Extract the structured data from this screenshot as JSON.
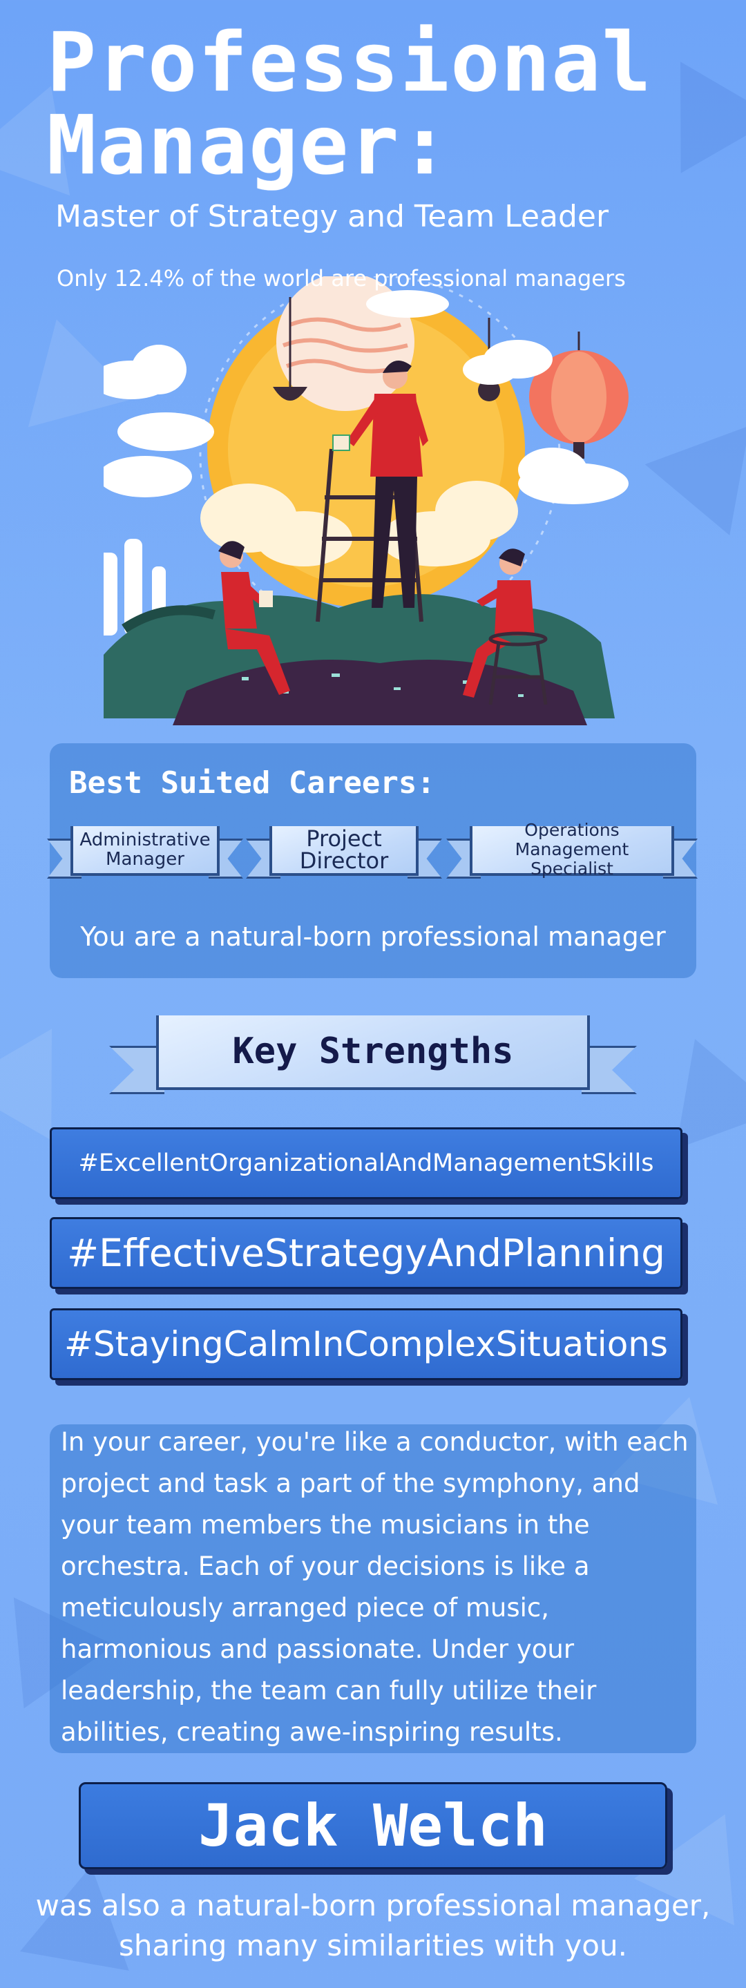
{
  "header": {
    "title_line1": "Professional",
    "title_line2": "Manager:",
    "subtitle": "Master of Strategy and Team Leader",
    "stat": "Only 12.4% of the world are professional managers"
  },
  "careers": {
    "heading": "Best Suited Careers:",
    "items": [
      {
        "line1": "Administrative",
        "line2": "Manager"
      },
      {
        "line1": "Project",
        "line2": "Director"
      },
      {
        "line1": "Operations",
        "line2": "Management Specialist"
      }
    ],
    "summary": "You are a natural-born professional manager"
  },
  "strengths": {
    "heading": "Key Strengths",
    "tags": [
      "#ExcellentOrganizationalAndManagementSkills",
      "#EffectiveStrategyAndPlanning",
      "#StayingCalmInComplexSituations"
    ]
  },
  "description": "In your career, you're like a conductor, with each project and task a part of the symphony, and your team members the musicians in the orchestra. Each of your decisions is like a meticulously arranged piece of music, harmonious and passionate. Under your leadership, the team can fully utilize their abilities, creating awe-inspiring results.",
  "famous": {
    "name": "Jack Welch",
    "footer": "was also a natural-born professional manager, sharing many similarities with you."
  },
  "colors": {
    "background": "#7fb1f9",
    "tag_fill": "#3a78dc",
    "outline": "#0c1f4a",
    "ribbon": "#c3dafa",
    "sun": "#f9b731",
    "red_figure": "#d6262e"
  }
}
